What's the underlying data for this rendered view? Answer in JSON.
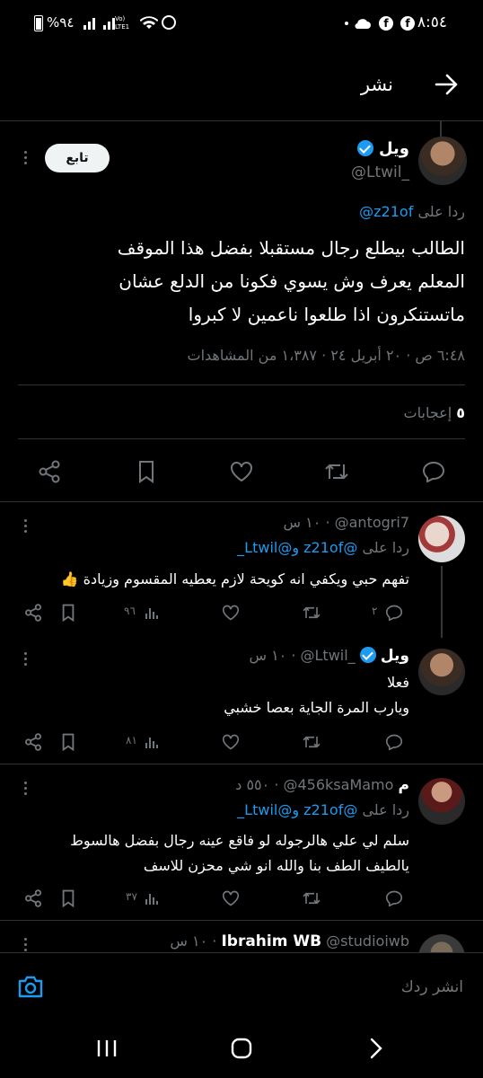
{
  "status_bar": {
    "time": "٨:٥٤",
    "battery": "%٩٤",
    "network": "Vo) LTE1",
    "icons": [
      "cloud-icon",
      "facebook-icon",
      "facebook-icon",
      "wifi-icon",
      "signal-icon",
      "battery-icon",
      "alarm-icon"
    ]
  },
  "header": {
    "title": "نشر",
    "back_icon": "arrow-right-icon"
  },
  "main_post": {
    "display_name": "ويل",
    "handle": "@Ltwil_",
    "follow_label": "تابع",
    "reply_to_prefix": "ردا على",
    "reply_to_handle": "@z21of",
    "text_lines": [
      "الطالب بيطلع رجال مستقبلا بفضل هذا الموقف",
      "المعلم يعرف وش يسوي فكونا من الدلع عشان",
      "ماتستنكرون اذا طلعوا ناعمين لا كبروا"
    ],
    "meta": "٦:٤٨ ص · ٢٠ أبريل ٢٤ · ١،٣٨٧ من المشاهدات",
    "likes_count": "٥",
    "likes_label": "إعجابات"
  },
  "replies": [
    {
      "author_name": "",
      "handle": "@antogri7",
      "time": "١٠ س",
      "reply_to_prefix": "ردا على",
      "reply_to": "@z21of و@Ltwil_",
      "text_lines": [
        "تفهم حبي ويكفي انه كويحة لازم يعطيه المقسوم وزيادة 👍"
      ],
      "replies_count": "٢",
      "views": "٩٦"
    },
    {
      "author_name": "ويل",
      "handle": "@Ltwil_",
      "time": "١٠ س",
      "text_lines": [
        "فعلا",
        "ويارب المرة الجاية بعصا خشبي"
      ],
      "views": "٨١"
    },
    {
      "author_name": "م",
      "handle": "@456ksaMamo",
      "time": "٥٥٠ د",
      "reply_to_prefix": "ردا على",
      "reply_to": "@z21of و@Ltwil_",
      "text_lines": [
        "سلم لي علي هالرجوله لو فاقع عينه رجال بفضل هالسوط",
        "يالطيف الطف بنا والله انو شي محزن للاسف"
      ],
      "views": "٣٧"
    },
    {
      "author_name": "Ibrahim WB",
      "handle": "@studioiwb",
      "time": "١٠ س"
    }
  ],
  "compose": {
    "placeholder": "انشر ردك"
  }
}
